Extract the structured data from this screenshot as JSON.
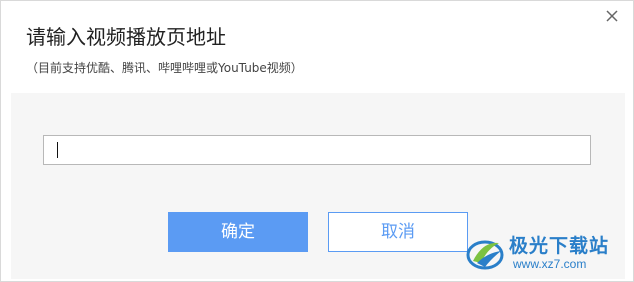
{
  "dialog": {
    "title": "请输入视频播放页地址",
    "subtitle": "（目前支持优酷、腾讯、哔哩哔哩或YouTube视频）",
    "close_icon": "close-icon"
  },
  "form": {
    "url_value": "",
    "confirm_label": "确定",
    "cancel_label": "取消"
  },
  "watermark": {
    "brand": "极光下载站",
    "url": "www.xz7.com"
  },
  "colors": {
    "accent": "#5b9bf3",
    "panel_bg": "#f6f6f6",
    "watermark": "#2a7fc9"
  }
}
